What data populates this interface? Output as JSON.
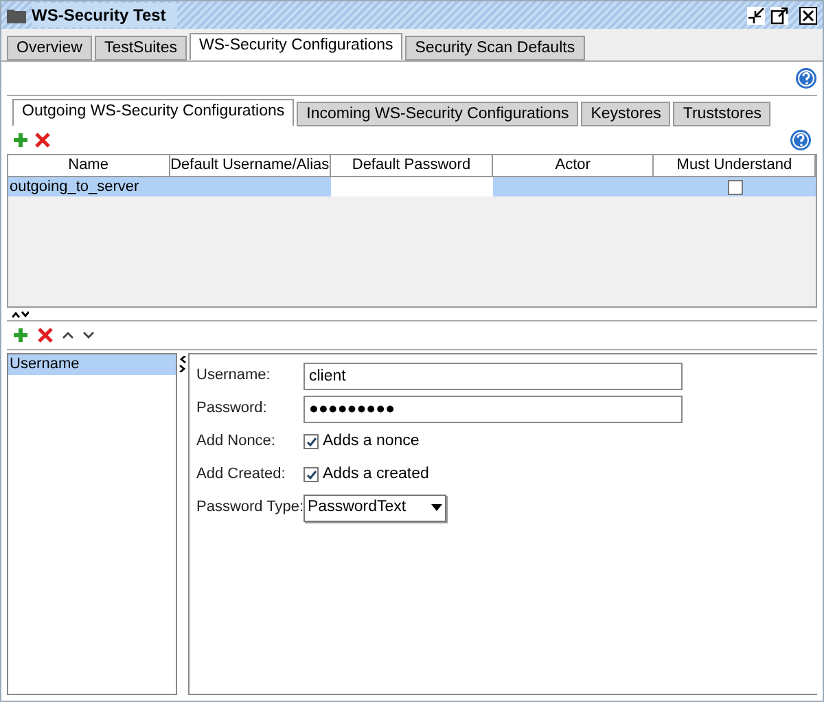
{
  "window": {
    "title": "WS-Security Test"
  },
  "tabs": [
    {
      "label": "Overview",
      "selected": false
    },
    {
      "label": "TestSuites",
      "selected": false
    },
    {
      "label": "WS-Security Configurations",
      "selected": true
    },
    {
      "label": "Security Scan Defaults",
      "selected": false
    }
  ],
  "sub_tabs": [
    {
      "label": "Outgoing WS-Security Configurations",
      "selected": true
    },
    {
      "label": "Incoming WS-Security Configurations",
      "selected": false
    },
    {
      "label": "Keystores",
      "selected": false
    },
    {
      "label": "Truststores",
      "selected": false
    }
  ],
  "table": {
    "columns": [
      "Name",
      "Default Username/Alias",
      "Default Password",
      "Actor",
      "Must Understand"
    ],
    "rows": [
      {
        "selected": true,
        "cells": [
          {
            "kind": "text",
            "text": "outgoing_to_server",
            "focused": false
          },
          {
            "kind": "text",
            "focused": false
          },
          {
            "kind": "text",
            "focused": true
          },
          {
            "kind": "text",
            "focused": false
          },
          {
            "kind": "checkbox",
            "checked": false,
            "focused": false
          }
        ]
      }
    ]
  },
  "entries": [
    {
      "label": "Username",
      "selected": true
    }
  ],
  "form": [
    {
      "kind": "text",
      "label": "Username:",
      "value": "client"
    },
    {
      "kind": "text",
      "label": "Password:",
      "value": "●●●●●●●●●"
    },
    {
      "kind": "checkbox",
      "label": "Add Nonce:",
      "text": "Adds a nonce",
      "checked": true
    },
    {
      "kind": "checkbox",
      "label": "Add Created:",
      "text": "Adds a created",
      "checked": true
    },
    {
      "kind": "select",
      "label": "Password Type:",
      "value": "PasswordText"
    }
  ]
}
